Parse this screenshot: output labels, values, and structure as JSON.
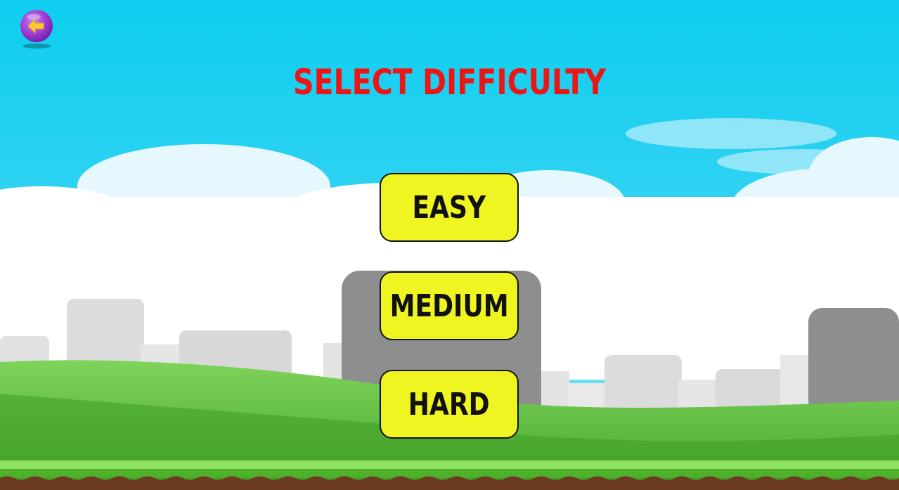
{
  "title": "SELECT DIFFICULTY",
  "buttons": [
    {
      "label": "EASY"
    },
    {
      "label": "MEDIUM"
    },
    {
      "label": "HARD"
    }
  ],
  "back_button": {
    "icon": "arrow-left-icon"
  },
  "colors": {
    "title": "#ec1616",
    "button_fill": "#eef520",
    "back_button": "#a03fd0",
    "back_arrow": "#f7c934",
    "sky_top": "#10cdef",
    "sky_bottom": "#5ee0f7",
    "grass": "#56b53a",
    "soil": "#6b3a1f"
  }
}
